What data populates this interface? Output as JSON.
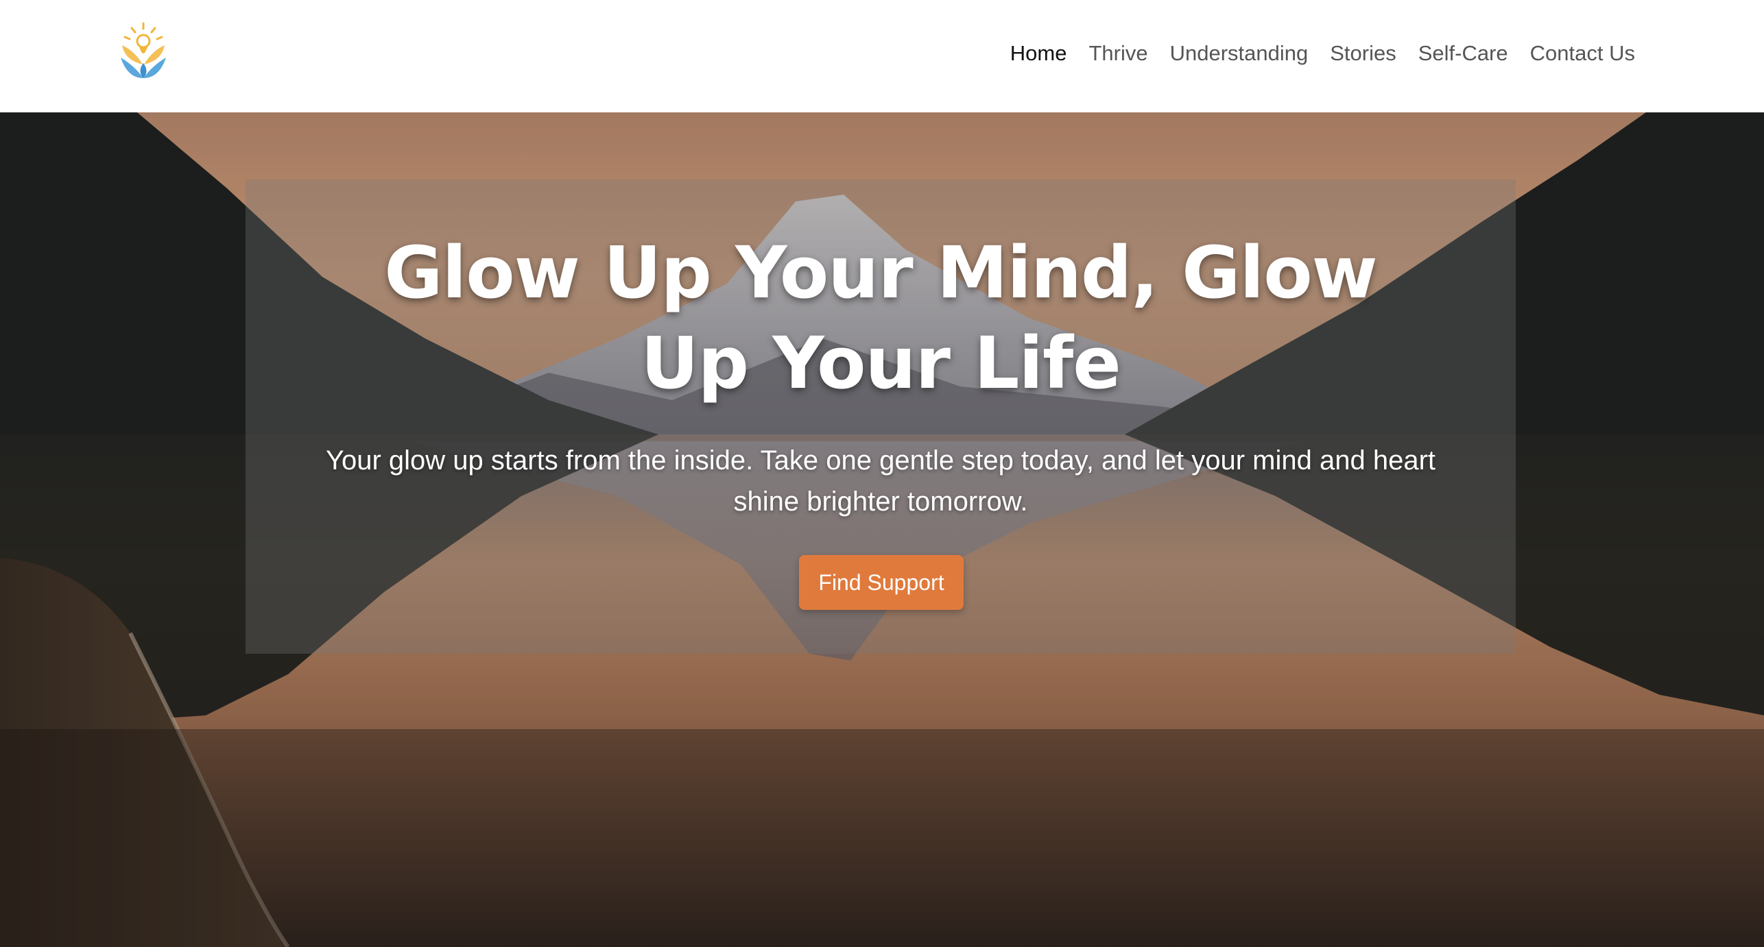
{
  "header": {
    "logo_icon": "sunrise-lotus-icon",
    "nav": {
      "home": "Home",
      "thrive": "Thrive",
      "understanding": "Understanding",
      "stories": "Stories",
      "self_care": "Self-Care",
      "contact": "Contact Us"
    },
    "active_item": "Home"
  },
  "hero": {
    "background": "mountain-lake-sunset-image",
    "title": "Glow Up Your Mind, Glow Up Your Life",
    "subtitle": "Your glow up starts from the inside. Take one gentle step today, and let your mind and heart shine brighter tomorrow.",
    "cta_label": "Find Support"
  },
  "colors": {
    "accent": "#e07a3c",
    "nav_text": "#555555",
    "nav_active": "#111111",
    "logo_sun": "#f2b53a",
    "logo_leaves": "#5aa7dd"
  }
}
